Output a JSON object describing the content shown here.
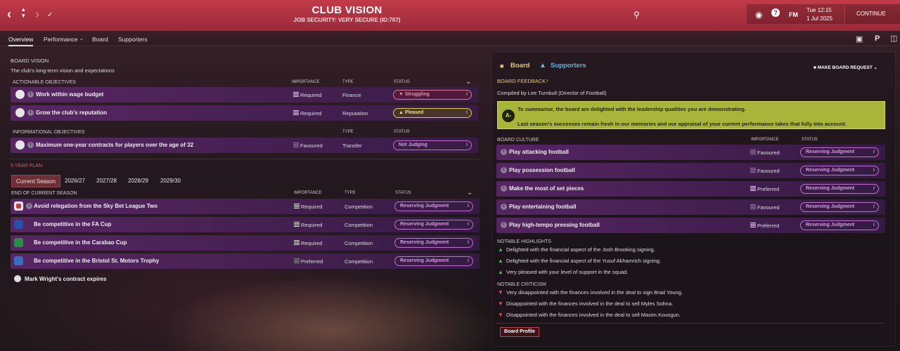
{
  "header": {
    "title": "CLUB VISION",
    "subtitle": "JOB SECURITY: VERY SECURE (ID:707)",
    "fm_label": "FM",
    "day_time": "Tue 12:15",
    "date": "1 Jul 2025",
    "continue_label": "CONTINUE"
  },
  "tabs": [
    {
      "label": "Overview"
    },
    {
      "label": "Performance"
    },
    {
      "label": "Board"
    },
    {
      "label": "Supporters"
    }
  ],
  "board_vision": {
    "heading": "BOARD VISION",
    "description": "The club's long-term vision and expectations",
    "actionable_heading": "ACTIONABLE OBJECTIVES",
    "col_importance": "IMPORTANCE",
    "col_type": "TYPE",
    "col_status": "STATUS",
    "actionable": [
      {
        "label": "Work within wage budget",
        "importance": "Required",
        "type": "Finance",
        "status": "Struggling"
      },
      {
        "label": "Grow the club's reputation",
        "importance": "Required",
        "type": "Reputation",
        "status": "Pleased"
      }
    ],
    "informational_heading": "INFORMATIONAL OBJECTIVES",
    "informational": [
      {
        "label": "Maximum one-year contracts for players over the age of 32",
        "importance": "Favoured",
        "type": "Transfer",
        "status": "Not Judging"
      }
    ]
  },
  "plan": {
    "heading": "5 YEAR PLAN",
    "tabs": [
      "Current Season",
      "2026/27",
      "2027/28",
      "2028/29",
      "2029/30"
    ],
    "subheading": "END OF CURRENT SEASON",
    "rows": [
      {
        "label": "Avoid relegation from the Sky Bet League Two",
        "importance": "Required",
        "type": "Competition",
        "status": "Reserving Judgment"
      },
      {
        "label": "Be competitive in the FA Cup",
        "importance": "Required",
        "type": "Competition",
        "status": "Reserving Judgment"
      },
      {
        "label": "Be competitive in the Carabao Cup",
        "importance": "Required",
        "type": "Competition",
        "status": "Reserving Judgment"
      },
      {
        "label": "Be competitive in the Bristol St. Motors Trophy",
        "importance": "Preferred",
        "type": "Competition",
        "status": "Reserving Judgment"
      }
    ],
    "contract_note": "Mark Wright's contract expires"
  },
  "right": {
    "tab_board": "Board",
    "tab_supporters": "Supporters",
    "request_label": "MAKE BOARD REQUEST",
    "feedback_heading": "BOARD FEEDBACK",
    "compiled_by": "Compiled by Lee Turnbull (Director of Football)",
    "grade": "A-",
    "summary1": "To summarise, the board are delighted with the leadership qualities you are demonstrating.",
    "summary2": "Last season's successes remain fresh in our memories and our appraisal of your current performance takes that fully into account.",
    "culture_heading": "BOARD CULTURE",
    "col_importance": "IMPORTANCE",
    "col_status": "STATUS",
    "culture": [
      {
        "label": "Play attacking football",
        "importance": "Favoured",
        "status": "Reserving Judgment"
      },
      {
        "label": "Play possession football",
        "importance": "Favoured",
        "status": "Reserving Judgment"
      },
      {
        "label": "Make the most of set pieces",
        "importance": "Preferred",
        "status": "Reserving Judgment"
      },
      {
        "label": "Play entertaining football",
        "importance": "Favoured",
        "status": "Reserving Judgment"
      },
      {
        "label": "Play high-tempo pressing football",
        "importance": "Preferred",
        "status": "Reserving Judgment"
      }
    ],
    "highlights_heading": "NOTABLE HIGHLIGHTS",
    "highlights": [
      "Delighted with the financial aspect of the Josh Brooking signing.",
      "Delighted with the financial aspect of the Yusuf Akhamrich signing.",
      "Very pleased with your level of support in the squad."
    ],
    "criticism_heading": "NOTABLE CRITICISM",
    "criticism": [
      "Very disappointed with the finances involved in the deal to sign Brad Young.",
      "Disappointed with the finances involved in the deal to sell Myles Sohna.",
      "Disappointed with the finances involved in the deal to sell Maxim Kouogun."
    ],
    "profile_button": "Board Profile"
  }
}
